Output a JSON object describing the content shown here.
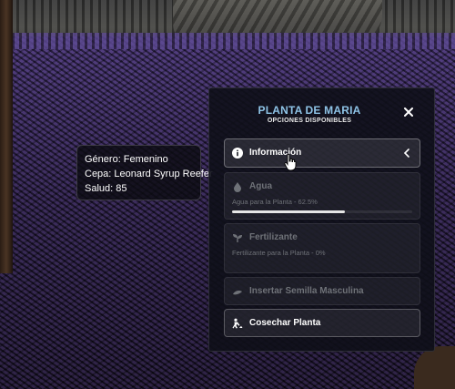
{
  "info_box": {
    "genero": "Género: Femenino",
    "cepa": "Cepa: Leonard Syrup Reefer",
    "salud": "Salud: 85"
  },
  "panel": {
    "title": "PLANTA DE MARIA",
    "subtitle": "OPCIONES DISPONIBLES",
    "close_icon": "close-icon",
    "options": [
      {
        "id": "informacion",
        "label": "Información",
        "icon": "info-circle-icon",
        "state": "active"
      },
      {
        "id": "agua",
        "label": "Agua",
        "desc": "Agua para la Planta - 62.5%",
        "icon": "water-drop-icon",
        "state": "disabled",
        "progress": 0.625
      },
      {
        "id": "fertilizante",
        "label": "Fertilizante",
        "desc": "Fertilizante para la Planta - 0%",
        "icon": "sprout-icon",
        "state": "disabled",
        "progress": 0
      },
      {
        "id": "semilla",
        "label": "Insertar Semilla Masculina",
        "icon": "seed-icon",
        "state": "disabled"
      },
      {
        "id": "cosechar",
        "label": "Cosechar Planta",
        "icon": "harvest-person-icon",
        "state": "enabled"
      }
    ]
  },
  "colors": {
    "title": "#8ec3e6",
    "panel_bg": "#0e1018",
    "disabled_text": "#6f7278",
    "progress_fill": "#e6e6e6"
  }
}
